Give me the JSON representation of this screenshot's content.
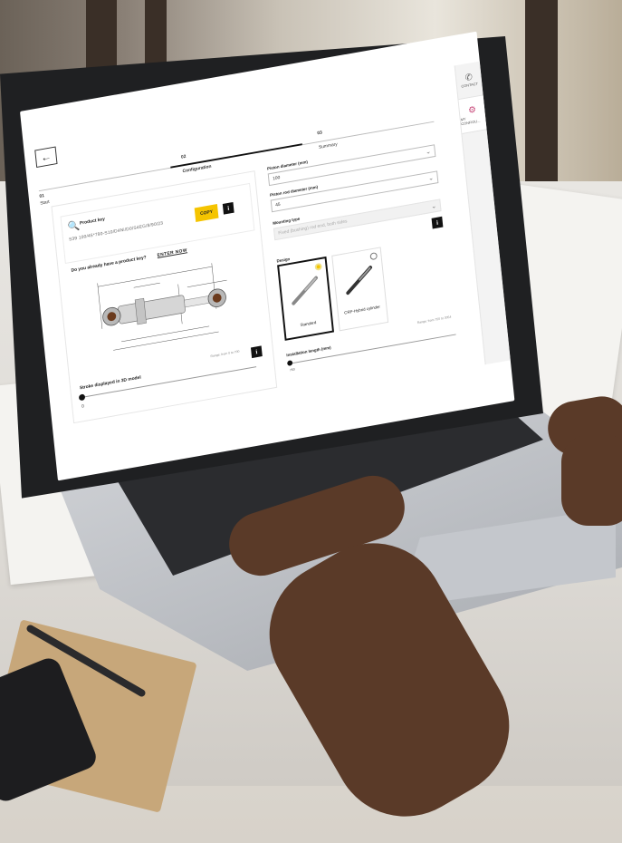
{
  "header": {
    "back_icon": "arrow-left-icon",
    "steps": [
      {
        "number": "01",
        "label": "Start"
      },
      {
        "number": "02",
        "label": "Configuration"
      },
      {
        "number": "03",
        "label": "Summary"
      }
    ]
  },
  "side_tabs": [
    {
      "icon": "phone-icon",
      "label": "CONTACT"
    },
    {
      "icon": "cylinder-icon",
      "label": "MY CONFIGU..."
    }
  ],
  "product_key": {
    "icon": "key-icon",
    "label": "Product key",
    "value": "S39 100/45*790-S10/D4Ni/D0/S4EG/8/90/23",
    "copy_label": "COPY",
    "info_icon": "info-icon",
    "question": "Do you already have a product key?",
    "enter_now": "ENTER NOW"
  },
  "stroke": {
    "range_text": "Range: from 0 to 700",
    "label": "Stroke displayed in 3D model",
    "value": "0"
  },
  "form": {
    "piston_diameter": {
      "label": "Piston diameter (mm)",
      "value": "100"
    },
    "rod_diameter": {
      "label": "Piston rod diameter (mm)",
      "value": "45"
    },
    "mounting_type": {
      "label": "Mounting type",
      "placeholder": "Fixed (bushing) rod end, both sides"
    },
    "design": {
      "label": "Design",
      "options": [
        {
          "label": "Standard",
          "selected": true
        },
        {
          "label": "CRP-Hybrid cylinder",
          "selected": false
        }
      ]
    },
    "install_range": "Range: from 750 to 3054",
    "installation_length": {
      "label": "Installation length (mm)",
      "value": "750"
    }
  },
  "colors": {
    "accent": "#f5c400",
    "dark": "#111111"
  }
}
